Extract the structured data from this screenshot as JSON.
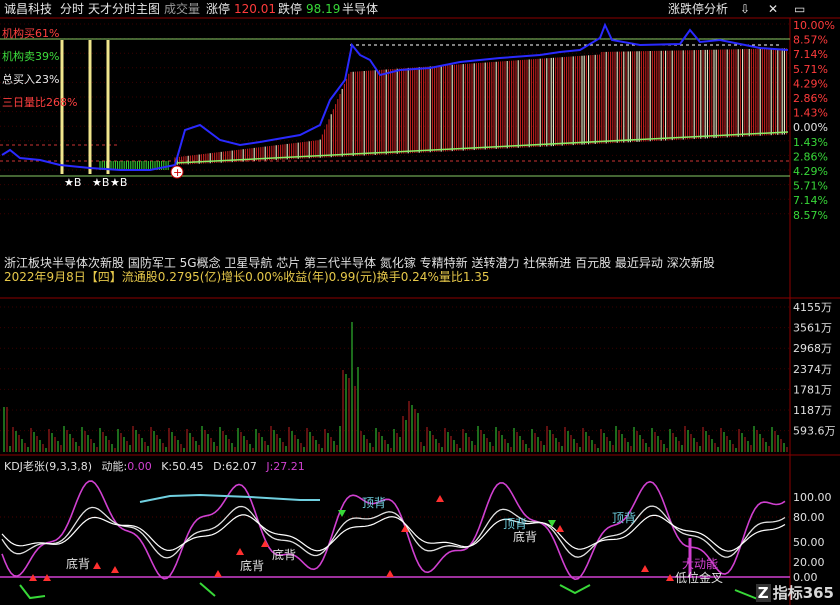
{
  "header": {
    "stock_name": "诚昌科技",
    "tab_timeshare": "分时",
    "main_chart_name": "天才分时主图",
    "volume_label": "成交量",
    "limit_up_label": "涨停",
    "limit_up_price": "120.01",
    "limit_down_label": "跌停",
    "limit_down_price": "98.19",
    "sector": "半导体",
    "analysis_label": "涨跌停分析",
    "icons": [
      "arrow-down-icon",
      "close-icon",
      "window-icon"
    ]
  },
  "price_indicators": [
    {
      "label": "机构买61%",
      "color": "#ff4040"
    },
    {
      "label": "机构卖39%",
      "color": "#3ddc3d"
    },
    {
      "label": "总买入23%",
      "color": "#e8e8e8"
    },
    {
      "label": "三日量比268%",
      "color": "#ff4040"
    }
  ],
  "price_axis": [
    "10.00%",
    "8.57%",
    "7.14%",
    "5.71%",
    "4.29%",
    "2.86%",
    "1.43%",
    "0.00%",
    "1.43%",
    "2.86%",
    "4.29%",
    "5.71%",
    "7.14%",
    "8.57%"
  ],
  "signals": [
    "★B",
    "★B",
    "★B"
  ],
  "concept_tags": "浙江板块半导体次新股 国防军工 5G概念 卫星导航 芯片 第三代半导体 氮化镓 专精特新 送转潜力 社保新进 百元股 最近异动 深次新股",
  "date_line": "2022年9月8日【四】流通股0.2795(亿)增长0.00%收益(年)0.99(元)换手0.24%量比1.35",
  "volume_axis": [
    "4155万",
    "3561万",
    "2968万",
    "2374万",
    "1781万",
    "1187万",
    "593.6万"
  ],
  "kdj": {
    "name": "KDJ老张(9,3,3,8)",
    "power_label": "动能:",
    "power_value": "0.00",
    "k_label": "K:",
    "k_value": "50.45",
    "d_label": "D:",
    "d_value": "62.07",
    "j_label": "J:",
    "j_value": "27.21",
    "axis": [
      "100.00",
      "80.00",
      "50.00",
      "20.00",
      "0.00"
    ],
    "annotations": [
      "底背",
      "底背",
      "底背",
      "顶背",
      "底背",
      "顶背",
      "顶背",
      "大动能",
      "低位金叉"
    ]
  },
  "watermark": "指标365",
  "colors": {
    "up": "#ff3b3b",
    "down": "#38d838",
    "blue": "#2a2aff",
    "yellow": "#f0e68c",
    "magenta": "#d040d0"
  }
}
